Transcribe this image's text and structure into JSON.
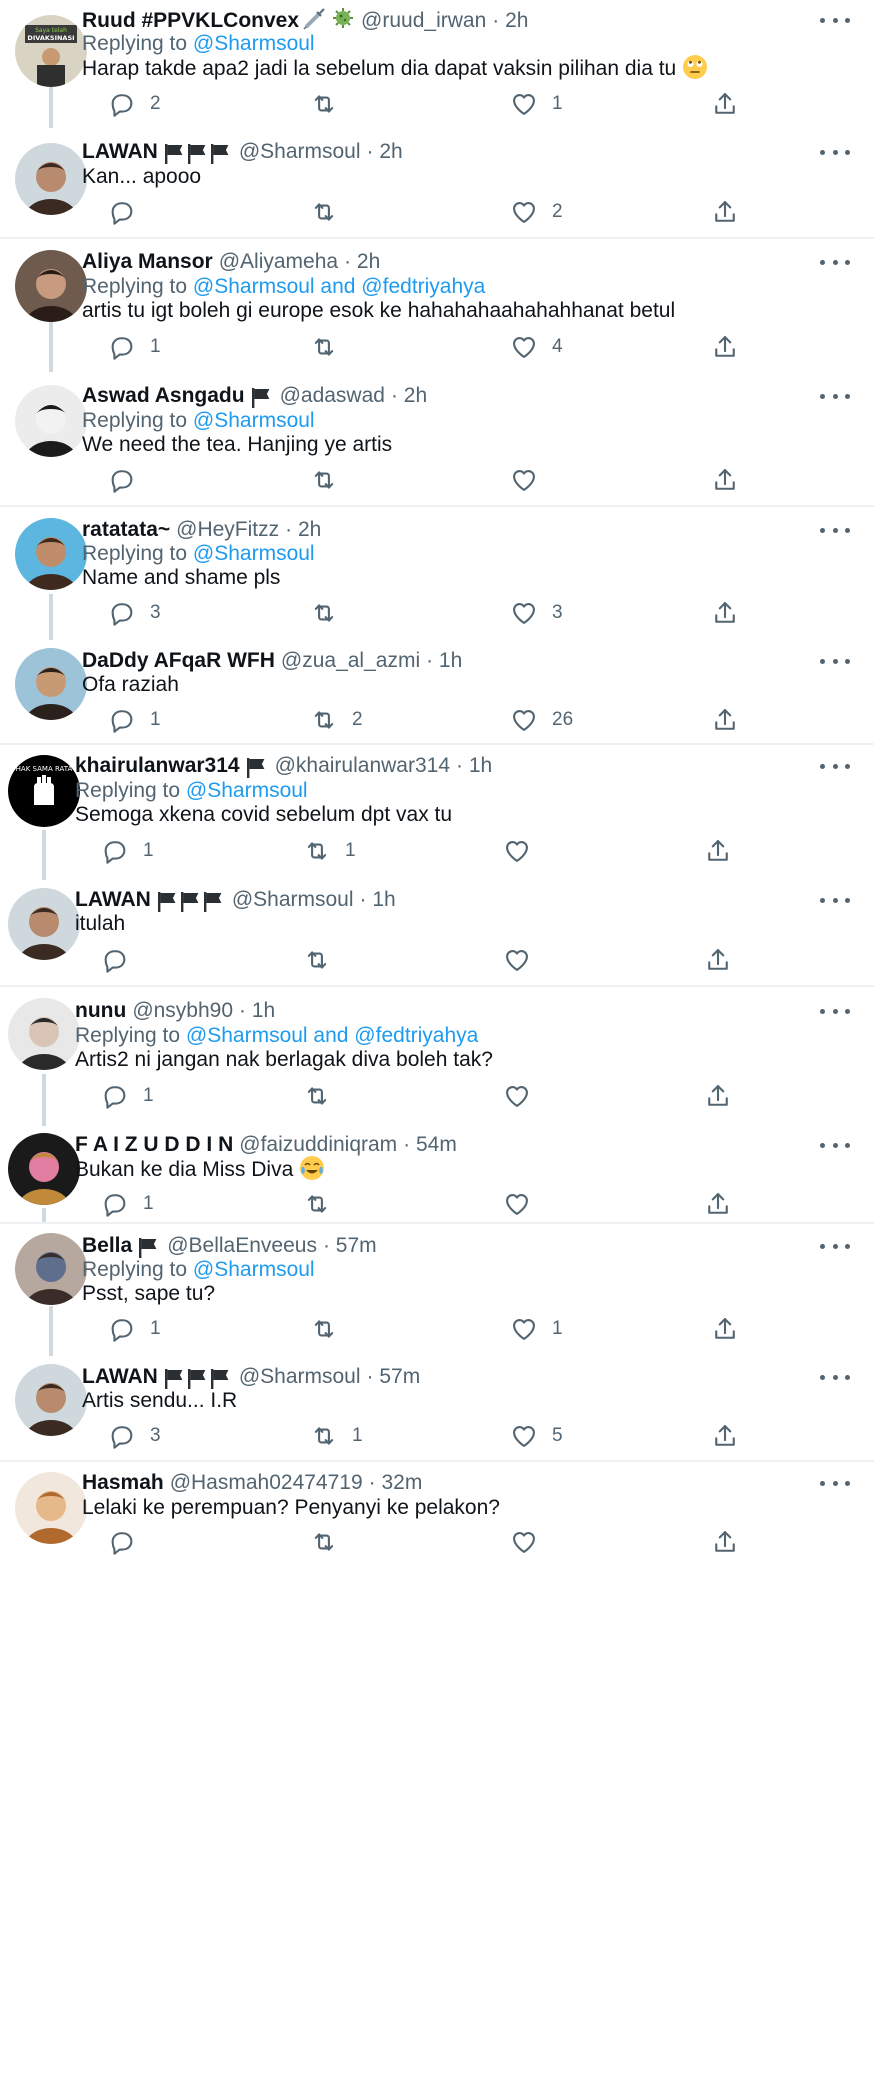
{
  "tweets": [
    {
      "name": "Ruud #PPVKLConvex",
      "badges": [
        "syringe",
        "virus"
      ],
      "flags": 0,
      "handle": "@ruud_irwan",
      "time": "· 2h",
      "replying_prefix": "Replying to ",
      "replying_to": "@Sharmsoul",
      "text": "Harap takde apa2 jadi la sebelum dia dapat vaksin pilihan dia tu",
      "emoji": "rolling-eyes",
      "reply_count": "2",
      "retweet_count": "",
      "like_count": "1"
    },
    {
      "name": "LAWAN",
      "badges": [],
      "flags": 3,
      "handle": "@Sharmsoul",
      "time": "· 2h",
      "replying_prefix": "",
      "replying_to": "",
      "text": "Kan... apooo",
      "emoji": "",
      "reply_count": "",
      "retweet_count": "",
      "like_count": "2"
    },
    {
      "name": "Aliya Mansor",
      "badges": [],
      "flags": 0,
      "handle": "@Aliyameha",
      "time": "· 2h",
      "replying_prefix": "Replying to ",
      "replying_to": "@Sharmsoul and @fedtriyahya",
      "text": "artis tu igt boleh gi europe esok ke hahahahaahahahhanat betul",
      "emoji": "",
      "reply_count": "1",
      "retweet_count": "",
      "like_count": "4"
    },
    {
      "name": "Aswad Asngadu",
      "badges": [],
      "flags": 1,
      "handle": "@adaswad",
      "time": "· 2h",
      "replying_prefix": "Replying to ",
      "replying_to": "@Sharmsoul",
      "text": "We need the tea. Hanjing ye artis",
      "emoji": "",
      "reply_count": "",
      "retweet_count": "",
      "like_count": ""
    },
    {
      "name": "ratatata~",
      "badges": [],
      "flags": 0,
      "handle": "@HeyFitzz",
      "time": "· 2h",
      "replying_prefix": "Replying to ",
      "replying_to": "@Sharmsoul",
      "text": "Name and shame pls",
      "emoji": "",
      "reply_count": "3",
      "retweet_count": "",
      "like_count": "3"
    },
    {
      "name": "DaDdy AFqaR WFH",
      "badges": [],
      "flags": 0,
      "handle": "@zua_al_azmi",
      "time": "· 1h",
      "replying_prefix": "",
      "replying_to": "",
      "text": "Ofa raziah",
      "emoji": "",
      "reply_count": "1",
      "retweet_count": "2",
      "like_count": "26"
    },
    {
      "name": "khairulanwar314",
      "badges": [],
      "flags": 1,
      "handle": "@khairulanwar314",
      "time": "· 1h",
      "replying_prefix": "Replying to ",
      "replying_to": "@Sharmsoul",
      "text": "Semoga xkena covid sebelum dpt vax tu",
      "emoji": "",
      "reply_count": "1",
      "retweet_count": "1",
      "like_count": ""
    },
    {
      "name": "LAWAN",
      "badges": [],
      "flags": 3,
      "handle": "@Sharmsoul",
      "time": "· 1h",
      "replying_prefix": "",
      "replying_to": "",
      "text": "itulah",
      "emoji": "",
      "reply_count": "",
      "retweet_count": "",
      "like_count": ""
    },
    {
      "name": "nunu",
      "badges": [],
      "flags": 0,
      "handle": "@nsybh90",
      "time": "· 1h",
      "replying_prefix": "Replying to ",
      "replying_to": "@Sharmsoul and @fedtriyahya",
      "text": "Artis2 ni jangan nak berlagak diva boleh tak?",
      "emoji": "",
      "reply_count": "1",
      "retweet_count": "",
      "like_count": ""
    },
    {
      "name": "F A I Z U D D I N",
      "badges": [],
      "flags": 0,
      "handle": "@faizuddiniqram",
      "time": "· 54m",
      "replying_prefix": "",
      "replying_to": "",
      "text": "Bukan ke dia Miss Diva",
      "emoji": "tears-of-joy",
      "reply_count": "1",
      "retweet_count": "",
      "like_count": ""
    },
    {
      "name": "Bella",
      "badges": [],
      "flags": 1,
      "handle": "@BellaEnveeus",
      "time": "· 57m",
      "replying_prefix": "Replying to ",
      "replying_to": "@Sharmsoul",
      "text": "Psst, sape tu?",
      "emoji": "",
      "reply_count": "1",
      "retweet_count": "",
      "like_count": "1"
    },
    {
      "name": "LAWAN",
      "badges": [],
      "flags": 3,
      "handle": "@Sharmsoul",
      "time": "· 57m",
      "replying_prefix": "",
      "replying_to": "",
      "text": "Artis sendu... I.R",
      "emoji": "",
      "reply_count": "3",
      "retweet_count": "1",
      "like_count": "5"
    },
    {
      "name": "Hasmah",
      "badges": [],
      "flags": 0,
      "handle": "@Hasmah02474719",
      "time": "· 32m",
      "replying_prefix": "",
      "replying_to": "",
      "text": "Lelaki ke perempuan? Penyanyi ke pelakon?",
      "emoji": "",
      "reply_count": "",
      "retweet_count": "",
      "like_count": ""
    }
  ],
  "icons": {
    "reply": "reply-icon",
    "retweet": "retweet-icon",
    "like": "like-icon",
    "share": "share-icon",
    "more": "more-icon"
  },
  "colors": {
    "link": "#1d9bf0",
    "muted": "#536471",
    "text": "#0f1419",
    "thread": "#cfd9de"
  }
}
